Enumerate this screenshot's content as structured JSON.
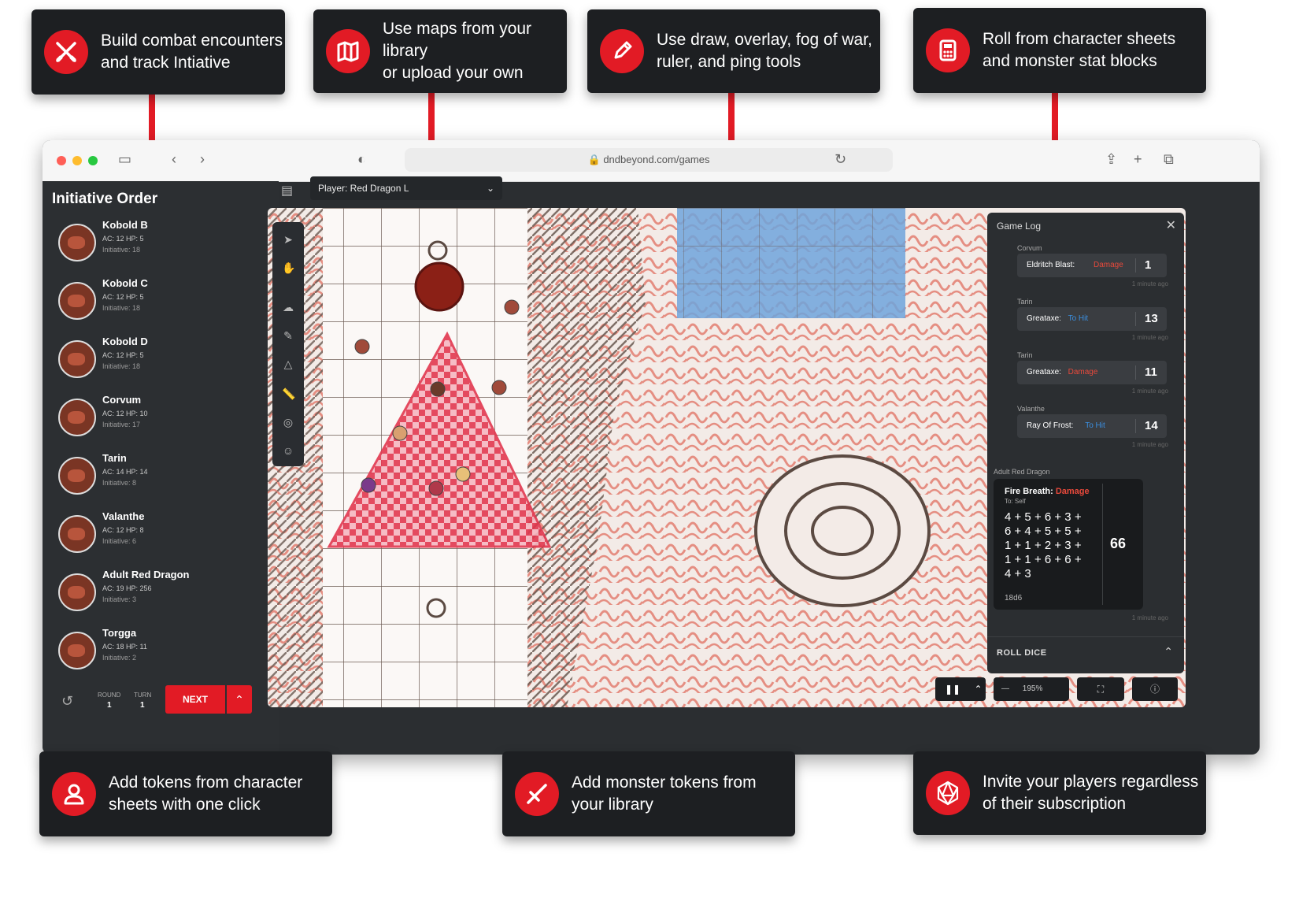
{
  "callouts": {
    "top": [
      {
        "text": "Build combat encounters\nand track Intiative",
        "icon": "crossed-swords-icon"
      },
      {
        "text": "Use maps from your library\nor upload your own",
        "icon": "map-icon"
      },
      {
        "text": "Use draw, overlay, fog of war,\nruler, and ping tools",
        "icon": "pencil-icon"
      },
      {
        "text": "Roll from character sheets\nand monster stat blocks",
        "icon": "calculator-icon"
      }
    ],
    "bottom": [
      {
        "text": "Add tokens from character\nsheets with one click",
        "icon": "user-icon"
      },
      {
        "text": "Add monster tokens from\nyour library",
        "icon": "sword-icon"
      },
      {
        "text": "Invite your players regardless\nof their subscription",
        "icon": "d20-icon"
      }
    ]
  },
  "browser": {
    "url": "dndbeyond.com/games"
  },
  "sidebar": {
    "title": "Initiative Order",
    "entries": [
      {
        "name": "Kobold B",
        "stats": "AC: 12   HP: 5",
        "initiative": "Initiative: 18"
      },
      {
        "name": "Kobold C",
        "stats": "AC: 12   HP: 5",
        "initiative": "Initiative: 18"
      },
      {
        "name": "Kobold D",
        "stats": "AC: 12   HP: 5",
        "initiative": "Initiative: 18"
      },
      {
        "name": "Corvum",
        "stats": "AC: 12   HP: 10",
        "initiative": "Initiative: 17"
      },
      {
        "name": "Tarin",
        "stats": "AC: 14   HP: 14",
        "initiative": "Initiative: 8"
      },
      {
        "name": "Valanthe",
        "stats": "AC: 12   HP: 8",
        "initiative": "Initiative: 6"
      },
      {
        "name": "Adult Red Dragon",
        "stats": "AC: 19   HP: 256",
        "initiative": "Initiative: 3"
      },
      {
        "name": "Torgga",
        "stats": "AC: 18   HP: 11",
        "initiative": "Initiative: 2"
      }
    ],
    "round_label": "ROUND",
    "round_value": "1",
    "turn_label": "TURN",
    "turn_value": "1",
    "next_label": "NEXT"
  },
  "header": {
    "player_select": "Player: Red Dragon L"
  },
  "gamelog": {
    "title": "Game Log",
    "entries": [
      {
        "actor": "Corvum",
        "action": "Eldritch Blast:",
        "kind": "Damage",
        "result": "1",
        "time": "1 minute ago"
      },
      {
        "actor": "Tarin",
        "action": "Greataxe:",
        "kind": "To Hit",
        "result": "13",
        "time": "1 minute ago"
      },
      {
        "actor": "Tarin",
        "action": "Greataxe:",
        "kind": "Damage",
        "result": "11",
        "time": "1 minute ago"
      },
      {
        "actor": "Valanthe",
        "action": "Ray Of Frost:",
        "kind": "To Hit",
        "result": "14",
        "time": "1 minute ago"
      }
    ],
    "big": {
      "actor": "Adult Red Dragon",
      "action": "Fire Breath:",
      "kind": "Damage",
      "target": "To: Self",
      "dice": "4 + 5 + 6 + 3 +\n6 + 4 + 5 + 5 +\n1 + 1 + 2 + 3 +\n1 + 1 + 6 + 6 +\n4 + 3",
      "total": "66",
      "formula": "18d6",
      "time": "1 minute ago"
    },
    "roll_dice_label": "ROLL DICE"
  },
  "bottombar": {
    "zoom": "195%"
  },
  "colors": {
    "accent": "#e21b25",
    "damage": "#e8493b",
    "tohit": "#3a8fe0",
    "panel": "#2b2e31"
  }
}
